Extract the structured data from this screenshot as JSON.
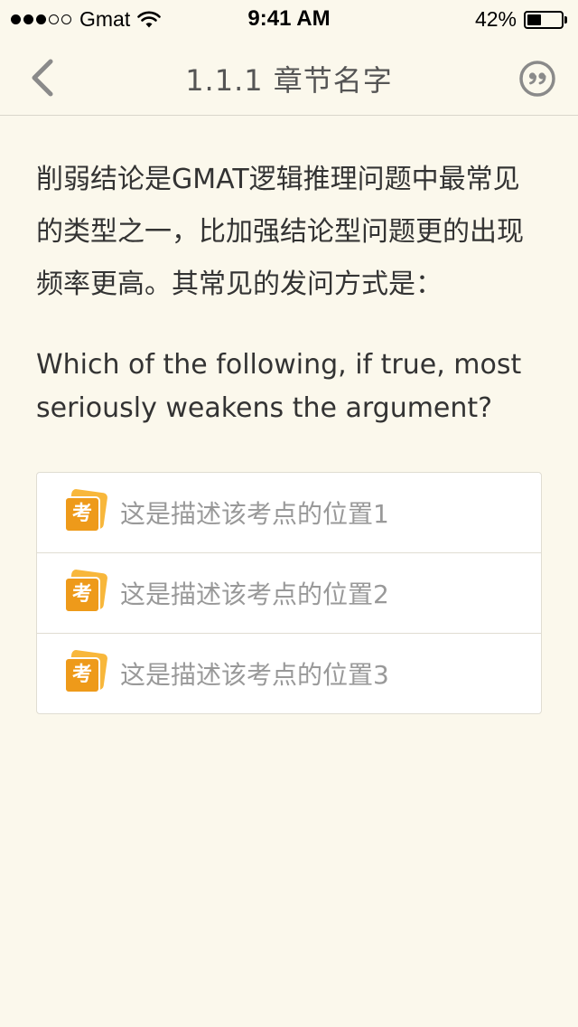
{
  "status_bar": {
    "carrier": "Gmat",
    "signal_bars_filled": 3,
    "signal_bars_total": 5,
    "time": "9:41 AM",
    "battery_percent_text": "42%",
    "battery_level": 0.42
  },
  "nav": {
    "back_icon": "chevron-left-icon",
    "title": "1.1.1 章节名字",
    "quote_icon": "quote-icon"
  },
  "content": {
    "intro_cn": "削弱结论是GMAT逻辑推理问题中最常见的类型之一，比加强结论型问题更的出现频率更高。其常见的发问方式是：",
    "intro_en": "Which of the following, if true, most seriously weakens the argument?",
    "points": [
      {
        "icon": "考",
        "label": "这是描述该考点的位置1"
      },
      {
        "icon": "考",
        "label": "这是描述该考点的位置2"
      },
      {
        "icon": "考",
        "label": "这是描述该考点的位置3"
      }
    ]
  },
  "colors": {
    "background": "#fbf8ec",
    "icon_orange": "#ee9a1a",
    "text_gray": "#999999",
    "nav_icon_gray": "#8a8a8a"
  }
}
